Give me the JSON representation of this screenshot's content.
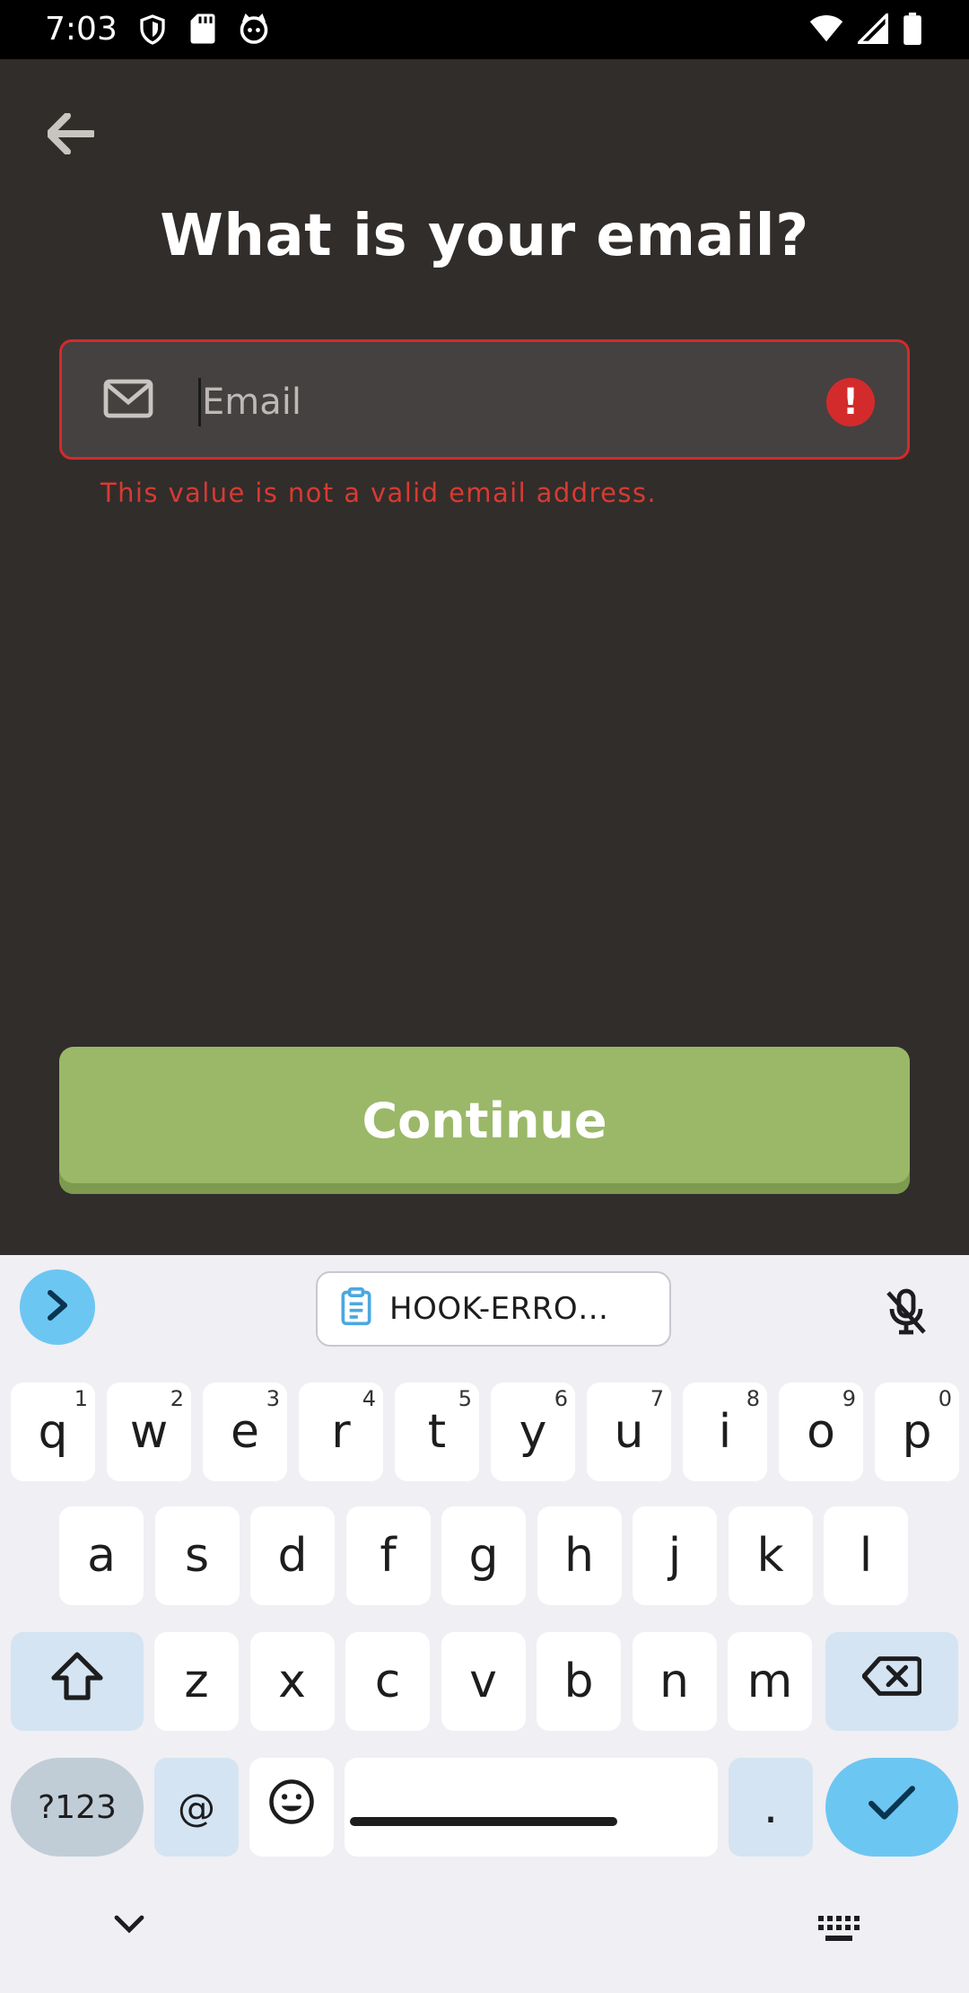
{
  "status_bar": {
    "time": "7:03",
    "left_icons": [
      "shield-icon",
      "sd-card-icon",
      "cat-face-icon"
    ],
    "right_icons": [
      "wifi-icon",
      "signal-icon",
      "battery-icon"
    ]
  },
  "screen": {
    "title": "What is your email?",
    "email_field": {
      "placeholder": "Email",
      "value": "",
      "error_message": "This value is not a valid email address."
    },
    "continue_label": "Continue"
  },
  "keyboard": {
    "clipboard_chip": "HOOK-ERRO…",
    "rows": [
      [
        {
          "k": "q",
          "h": "1"
        },
        {
          "k": "w",
          "h": "2"
        },
        {
          "k": "e",
          "h": "3"
        },
        {
          "k": "r",
          "h": "4"
        },
        {
          "k": "t",
          "h": "5"
        },
        {
          "k": "y",
          "h": "6"
        },
        {
          "k": "u",
          "h": "7"
        },
        {
          "k": "i",
          "h": "8"
        },
        {
          "k": "o",
          "h": "9"
        },
        {
          "k": "p",
          "h": "0"
        }
      ],
      [
        {
          "k": "a"
        },
        {
          "k": "s"
        },
        {
          "k": "d"
        },
        {
          "k": "f"
        },
        {
          "k": "g"
        },
        {
          "k": "h"
        },
        {
          "k": "j"
        },
        {
          "k": "k"
        },
        {
          "k": "l"
        }
      ],
      [
        {
          "k": "z"
        },
        {
          "k": "x"
        },
        {
          "k": "c"
        },
        {
          "k": "v"
        },
        {
          "k": "b"
        },
        {
          "k": "n"
        },
        {
          "k": "m"
        }
      ]
    ],
    "symbols_key": "?123",
    "at_key": "@",
    "period_key": "."
  },
  "colors": {
    "background": "#312d2b",
    "error": "#d32b2b",
    "button": "#9ab868",
    "keyboard_accent": "#6cc6f2"
  }
}
